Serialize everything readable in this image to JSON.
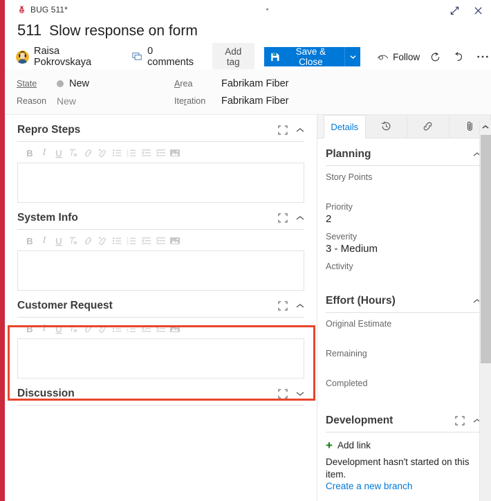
{
  "window": {
    "type_label": "BUG 511*",
    "bug_icon": "bug-icon",
    "expand_icon": "expand-icon",
    "close_icon": "close-icon",
    "accent_color": "#cc293d"
  },
  "header": {
    "work_item_id": "511",
    "work_item_title": "Slow response on form",
    "assignee": "Raisa Pokrovskaya",
    "comments_label": "0 comments",
    "add_tag_label": "Add tag",
    "save_label": "Save & Close",
    "save_dropdown_icon": "chevron-down-icon",
    "follow_label": "Follow",
    "refresh_icon": "refresh-icon",
    "revert_icon": "undo-icon",
    "more_icon": "ellipsis-icon",
    "primary_color": "#0078d7"
  },
  "fields": {
    "state_label": "State",
    "state_value": "New",
    "reason_label": "Reason",
    "reason_value": "New",
    "area_label": "Area",
    "area_value": "Fabrikam Fiber",
    "iteration_label": "Iteration",
    "iteration_value": "Fabrikam Fiber"
  },
  "editor_toolbar": [
    {
      "name": "bold-icon",
      "glyph": "B"
    },
    {
      "name": "italic-icon",
      "glyph": "I"
    },
    {
      "name": "underline-icon",
      "glyph": "U"
    },
    {
      "name": "clear-format-icon",
      "glyph": ""
    },
    {
      "name": "link-icon",
      "glyph": ""
    },
    {
      "name": "unlink-icon",
      "glyph": ""
    },
    {
      "name": "bullet-list-icon",
      "glyph": ""
    },
    {
      "name": "numbered-list-icon",
      "glyph": ""
    },
    {
      "name": "decrease-indent-icon",
      "glyph": ""
    },
    {
      "name": "increase-indent-icon",
      "glyph": ""
    },
    {
      "name": "insert-image-icon",
      "glyph": ""
    }
  ],
  "sections": [
    {
      "title": "Repro Steps",
      "expanded": true,
      "content": "",
      "highlighted": false
    },
    {
      "title": "System Info",
      "expanded": true,
      "content": "",
      "highlighted": false
    },
    {
      "title": "Customer Request",
      "expanded": true,
      "content": "",
      "highlighted": true
    },
    {
      "title": "Discussion",
      "expanded": false,
      "content": "",
      "highlighted": false
    }
  ],
  "highlight": {
    "color": "#e8452c"
  },
  "right_panel": {
    "tabs": [
      {
        "label": "Details",
        "icon": "details-tab",
        "active": true
      },
      {
        "label": "",
        "icon": "history-icon",
        "active": false
      },
      {
        "label": "",
        "icon": "link-icon",
        "active": false
      },
      {
        "label": "",
        "icon": "attachment-icon",
        "active": false
      }
    ],
    "planning": {
      "title": "Planning",
      "fields": [
        {
          "label": "Story Points",
          "value": ""
        },
        {
          "label": "Priority",
          "value": "2"
        },
        {
          "label": "Severity",
          "value": "3 - Medium"
        },
        {
          "label": "Activity",
          "value": ""
        }
      ]
    },
    "effort": {
      "title": "Effort (Hours)",
      "fields": [
        {
          "label": "Original Estimate",
          "value": ""
        },
        {
          "label": "Remaining",
          "value": ""
        },
        {
          "label": "Completed",
          "value": ""
        }
      ]
    },
    "development": {
      "title": "Development",
      "add_link_label": "Add link",
      "note": "Development hasn't started on this item.",
      "branch_link": "Create a new branch"
    }
  }
}
